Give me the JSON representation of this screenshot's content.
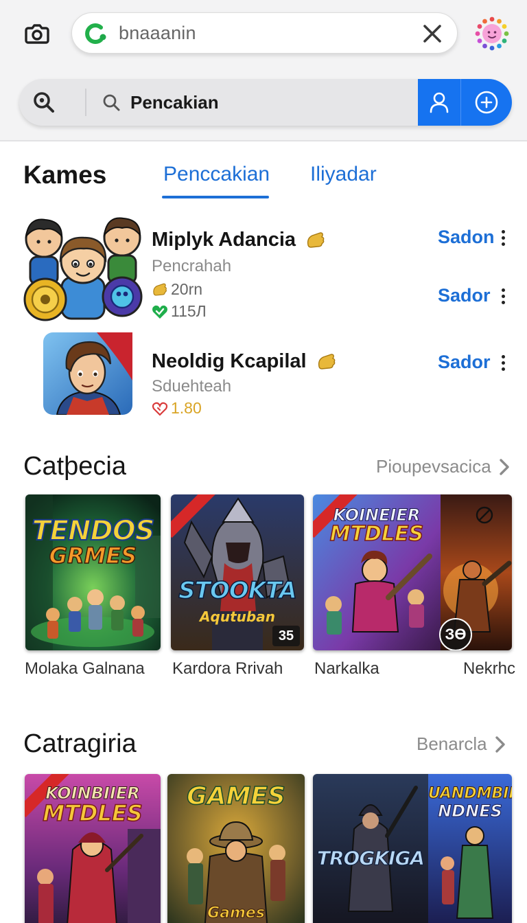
{
  "header": {
    "url_text": "bnaaanin",
    "search_placeholder": "Pencakian"
  },
  "tabs_section": {
    "title": "Kames",
    "tabs": [
      {
        "label": "Penccakian",
        "active": true
      },
      {
        "label": "Iliyadar",
        "active": false
      }
    ]
  },
  "apps": [
    {
      "name": "Miplyk Adancia",
      "subtitle": "Pencrahah",
      "meta1": "20rn",
      "meta2": "115Л",
      "actions": [
        "Sadon",
        "Sador"
      ]
    },
    {
      "name": "Neoldig Kcapilal",
      "subtitle": "Sduehteah",
      "meta1": "1.80",
      "actions": [
        "Sador"
      ]
    }
  ],
  "category1": {
    "title": "Catþecia",
    "see_all": "Pioupevsacica",
    "cards": [
      {
        "art_title_1": "TENDOS",
        "art_title_2": "GRMES",
        "label": "Molaka Galnana"
      },
      {
        "art_title_1": "STOOKTA",
        "art_title_2": "Aqutuban",
        "badge": "35",
        "label": "Kardora Rrivah"
      },
      {
        "art_title_1": "KOINEIER",
        "art_title_2": "MTDLES",
        "badge": "ЗӨ",
        "label": "Narkalka"
      },
      {
        "label": "Nekrhc"
      }
    ]
  },
  "category2": {
    "title": "Catragiria",
    "see_all": "Benarcla",
    "cards": [
      {
        "art_title_1": "KOINBIIER",
        "art_title_2": "MTDLES"
      },
      {
        "art_title_1": "GAMES",
        "art_title_2": "Games"
      },
      {
        "art_title_1": "TROGKIGA"
      },
      {
        "art_title_1": "UANDMBIIER",
        "art_title_2": "NDNES"
      }
    ]
  },
  "colors": {
    "accent_blue": "#1673f0",
    "link_blue": "#1d6fd6",
    "rating_green": "#1fae4b",
    "rating_red": "#d93a3a",
    "rating_gold": "#d9a425"
  }
}
